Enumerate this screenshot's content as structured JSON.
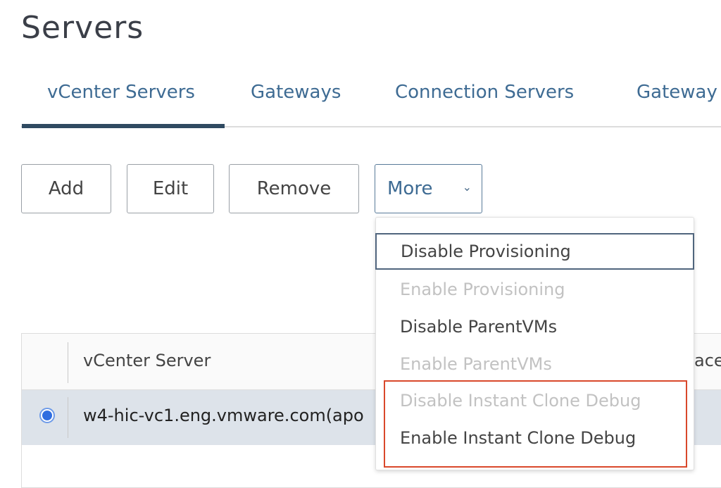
{
  "page_title": "Servers",
  "tabs": [
    {
      "label": "vCenter Servers",
      "active": true
    },
    {
      "label": "Gateways"
    },
    {
      "label": "Connection Servers"
    },
    {
      "label": "Gateway"
    }
  ],
  "toolbar": {
    "add": "Add",
    "edit": "Edit",
    "remove": "Remove",
    "more": "More",
    "more_icon": "chevron-down-icon"
  },
  "more_menu": {
    "items": [
      {
        "label": "Disable Provisioning",
        "enabled": true,
        "focused": true
      },
      {
        "label": "Enable Provisioning",
        "enabled": false
      },
      {
        "label": "Disable ParentVMs",
        "enabled": true
      },
      {
        "label": "Enable ParentVMs",
        "enabled": false
      },
      {
        "label": "Disable Instant Clone Debug",
        "enabled": false
      },
      {
        "label": "Enable Instant Clone Debug",
        "enabled": true
      }
    ],
    "highlight_color": "#d9482b"
  },
  "table": {
    "columns": [
      "vCenter Server",
      "ace"
    ],
    "rows": [
      {
        "selected": true,
        "vcenter": "w4-hic-vc1.eng.vmware.com(apo"
      }
    ]
  },
  "colors": {
    "accent": "#3e6b93",
    "selected_row": "#dde3ea",
    "radio": "#2f6de0"
  }
}
